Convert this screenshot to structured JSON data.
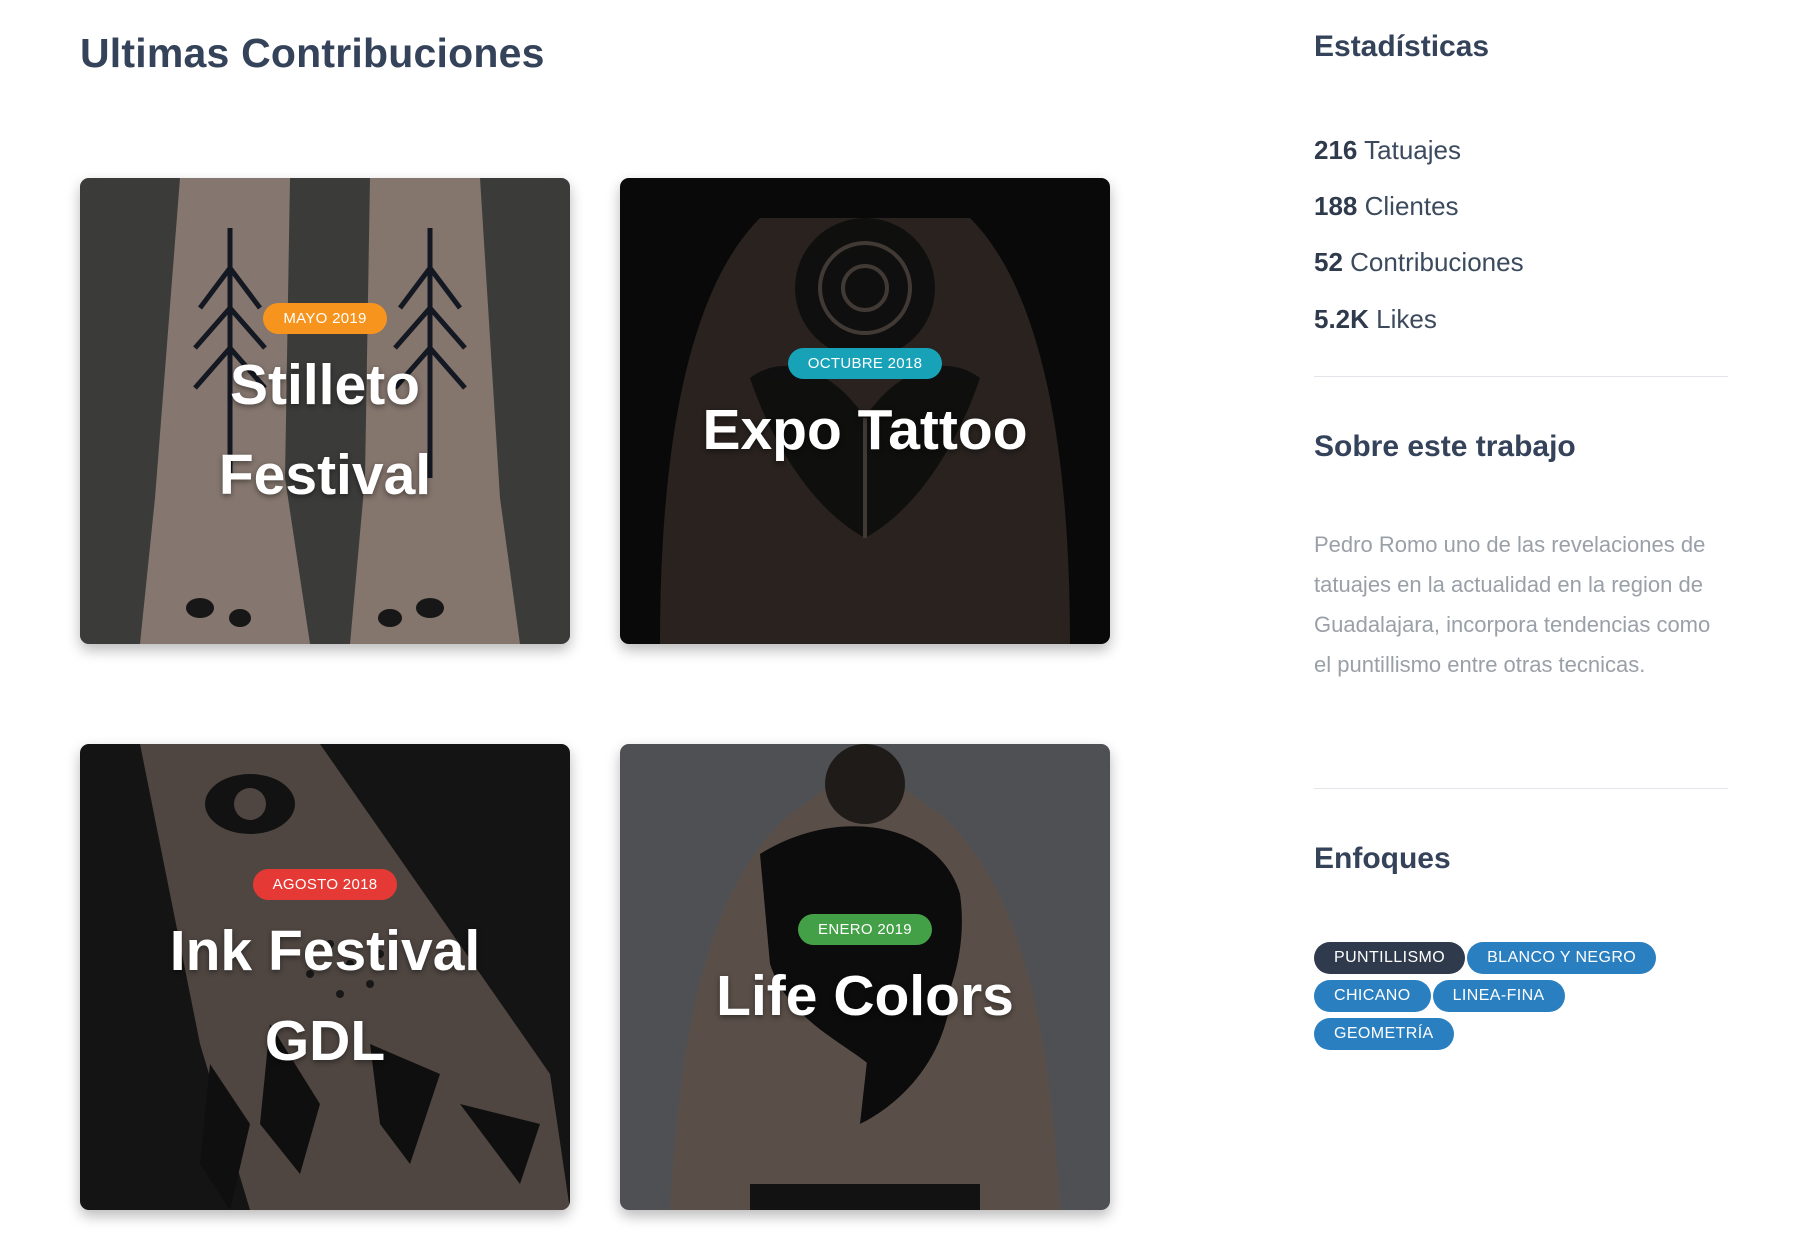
{
  "main": {
    "title": "Ultimas Contribuciones",
    "cards": [
      {
        "badge": "MAYO 2019",
        "badge_color": "#f7941d",
        "title_line1": "Stilleto",
        "title_line2": "Festival"
      },
      {
        "badge": "OCTUBRE 2018",
        "badge_color": "#17a2b8",
        "title_line1": "Expo Tattoo",
        "title_line2": ""
      },
      {
        "badge": "AGOSTO 2018",
        "badge_color": "#e53935",
        "title_line1": "Ink Festival",
        "title_line2": "GDL"
      },
      {
        "badge": "ENERO 2019",
        "badge_color": "#43a047",
        "title_line1": "Life Colors",
        "title_line2": ""
      }
    ]
  },
  "sidebar": {
    "stats_heading": "Estadísticas",
    "stats": [
      {
        "value": "216",
        "label": "Tatuajes"
      },
      {
        "value": "188",
        "label": "Clientes"
      },
      {
        "value": "52",
        "label": "Contribuciones"
      },
      {
        "value": "5.2K",
        "label": "Likes"
      }
    ],
    "about_heading": "Sobre este trabajo",
    "about_text": "Pedro Romo uno de las revelaciones de tatuajes en la actualidad en la region de Guadalajara, incorpora tendencias como el puntillismo entre otras tecnicas.",
    "focus_heading": "Enfoques",
    "tags": [
      {
        "label": "PUNTILLISMO",
        "color": "#2f3b4c"
      },
      {
        "label": "BLANCO Y NEGRO",
        "color": "#2a7fc1"
      },
      {
        "label": "CHICANO",
        "color": "#2a7fc1"
      },
      {
        "label": "LINEA-FINA",
        "color": "#2a7fc1"
      },
      {
        "label": "GEOMETRÍA",
        "color": "#2a7fc1"
      }
    ]
  }
}
